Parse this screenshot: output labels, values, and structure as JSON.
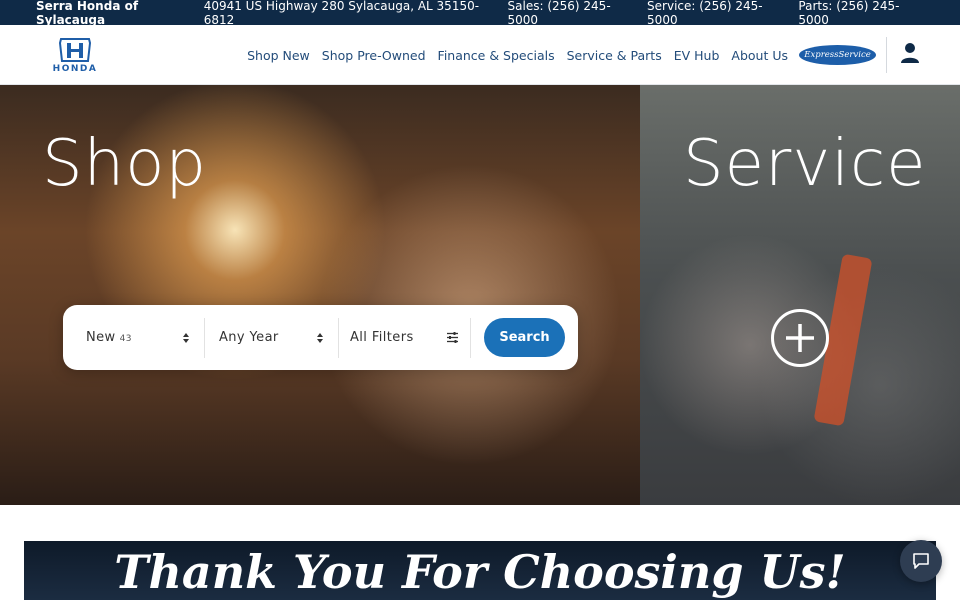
{
  "topbar": {
    "dealer_name": "Serra Honda of Sylacauga",
    "address": "40941 US Highway 280 Sylacauga, AL 35150-6812",
    "sales": "Sales: (256) 245-5000",
    "service": "Service: (256) 245-5000",
    "parts": "Parts: (256) 245-5000"
  },
  "nav": {
    "logo_text": "HONDA",
    "items": [
      {
        "label": "Shop New"
      },
      {
        "label": "Shop Pre-Owned"
      },
      {
        "label": "Finance & Specials"
      },
      {
        "label": "Service & Parts"
      },
      {
        "label": "EV Hub"
      },
      {
        "label": "About Us"
      }
    ],
    "express_service_label": "ExpressService"
  },
  "hero": {
    "shop_title": "Shop",
    "service_title": "Service"
  },
  "search": {
    "condition_value": "New",
    "condition_count": "43",
    "year_value": "Any Year",
    "filters_label": "All Filters",
    "search_label": "Search"
  },
  "banner": {
    "text": "Thank You For Choosing Us!"
  },
  "colors": {
    "topbar_bg": "#0f2a47",
    "nav_link": "#234c7a",
    "search_button": "#1b71b8",
    "honda_blue": "#1f5ea8",
    "chat_button": "#2e3d52"
  },
  "icons": {
    "user": "user-icon",
    "plus": "plus-circle-icon",
    "select_arrows": "up-down-arrow-icon",
    "filters": "sliders-icon",
    "chat": "chat-bubble-icon"
  }
}
